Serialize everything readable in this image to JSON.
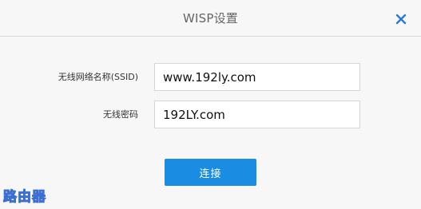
{
  "dialog": {
    "title": "WISP设置",
    "close_icon": "close-x-icon",
    "accent_color": "#1a8de3"
  },
  "form": {
    "ssid": {
      "label": "无线网络名称(SSID)",
      "value": "www.192ly.com"
    },
    "password": {
      "label": "无线密码",
      "value": "192LY.com"
    }
  },
  "actions": {
    "connect_label": "连接"
  },
  "watermark": {
    "text": "路由器"
  }
}
